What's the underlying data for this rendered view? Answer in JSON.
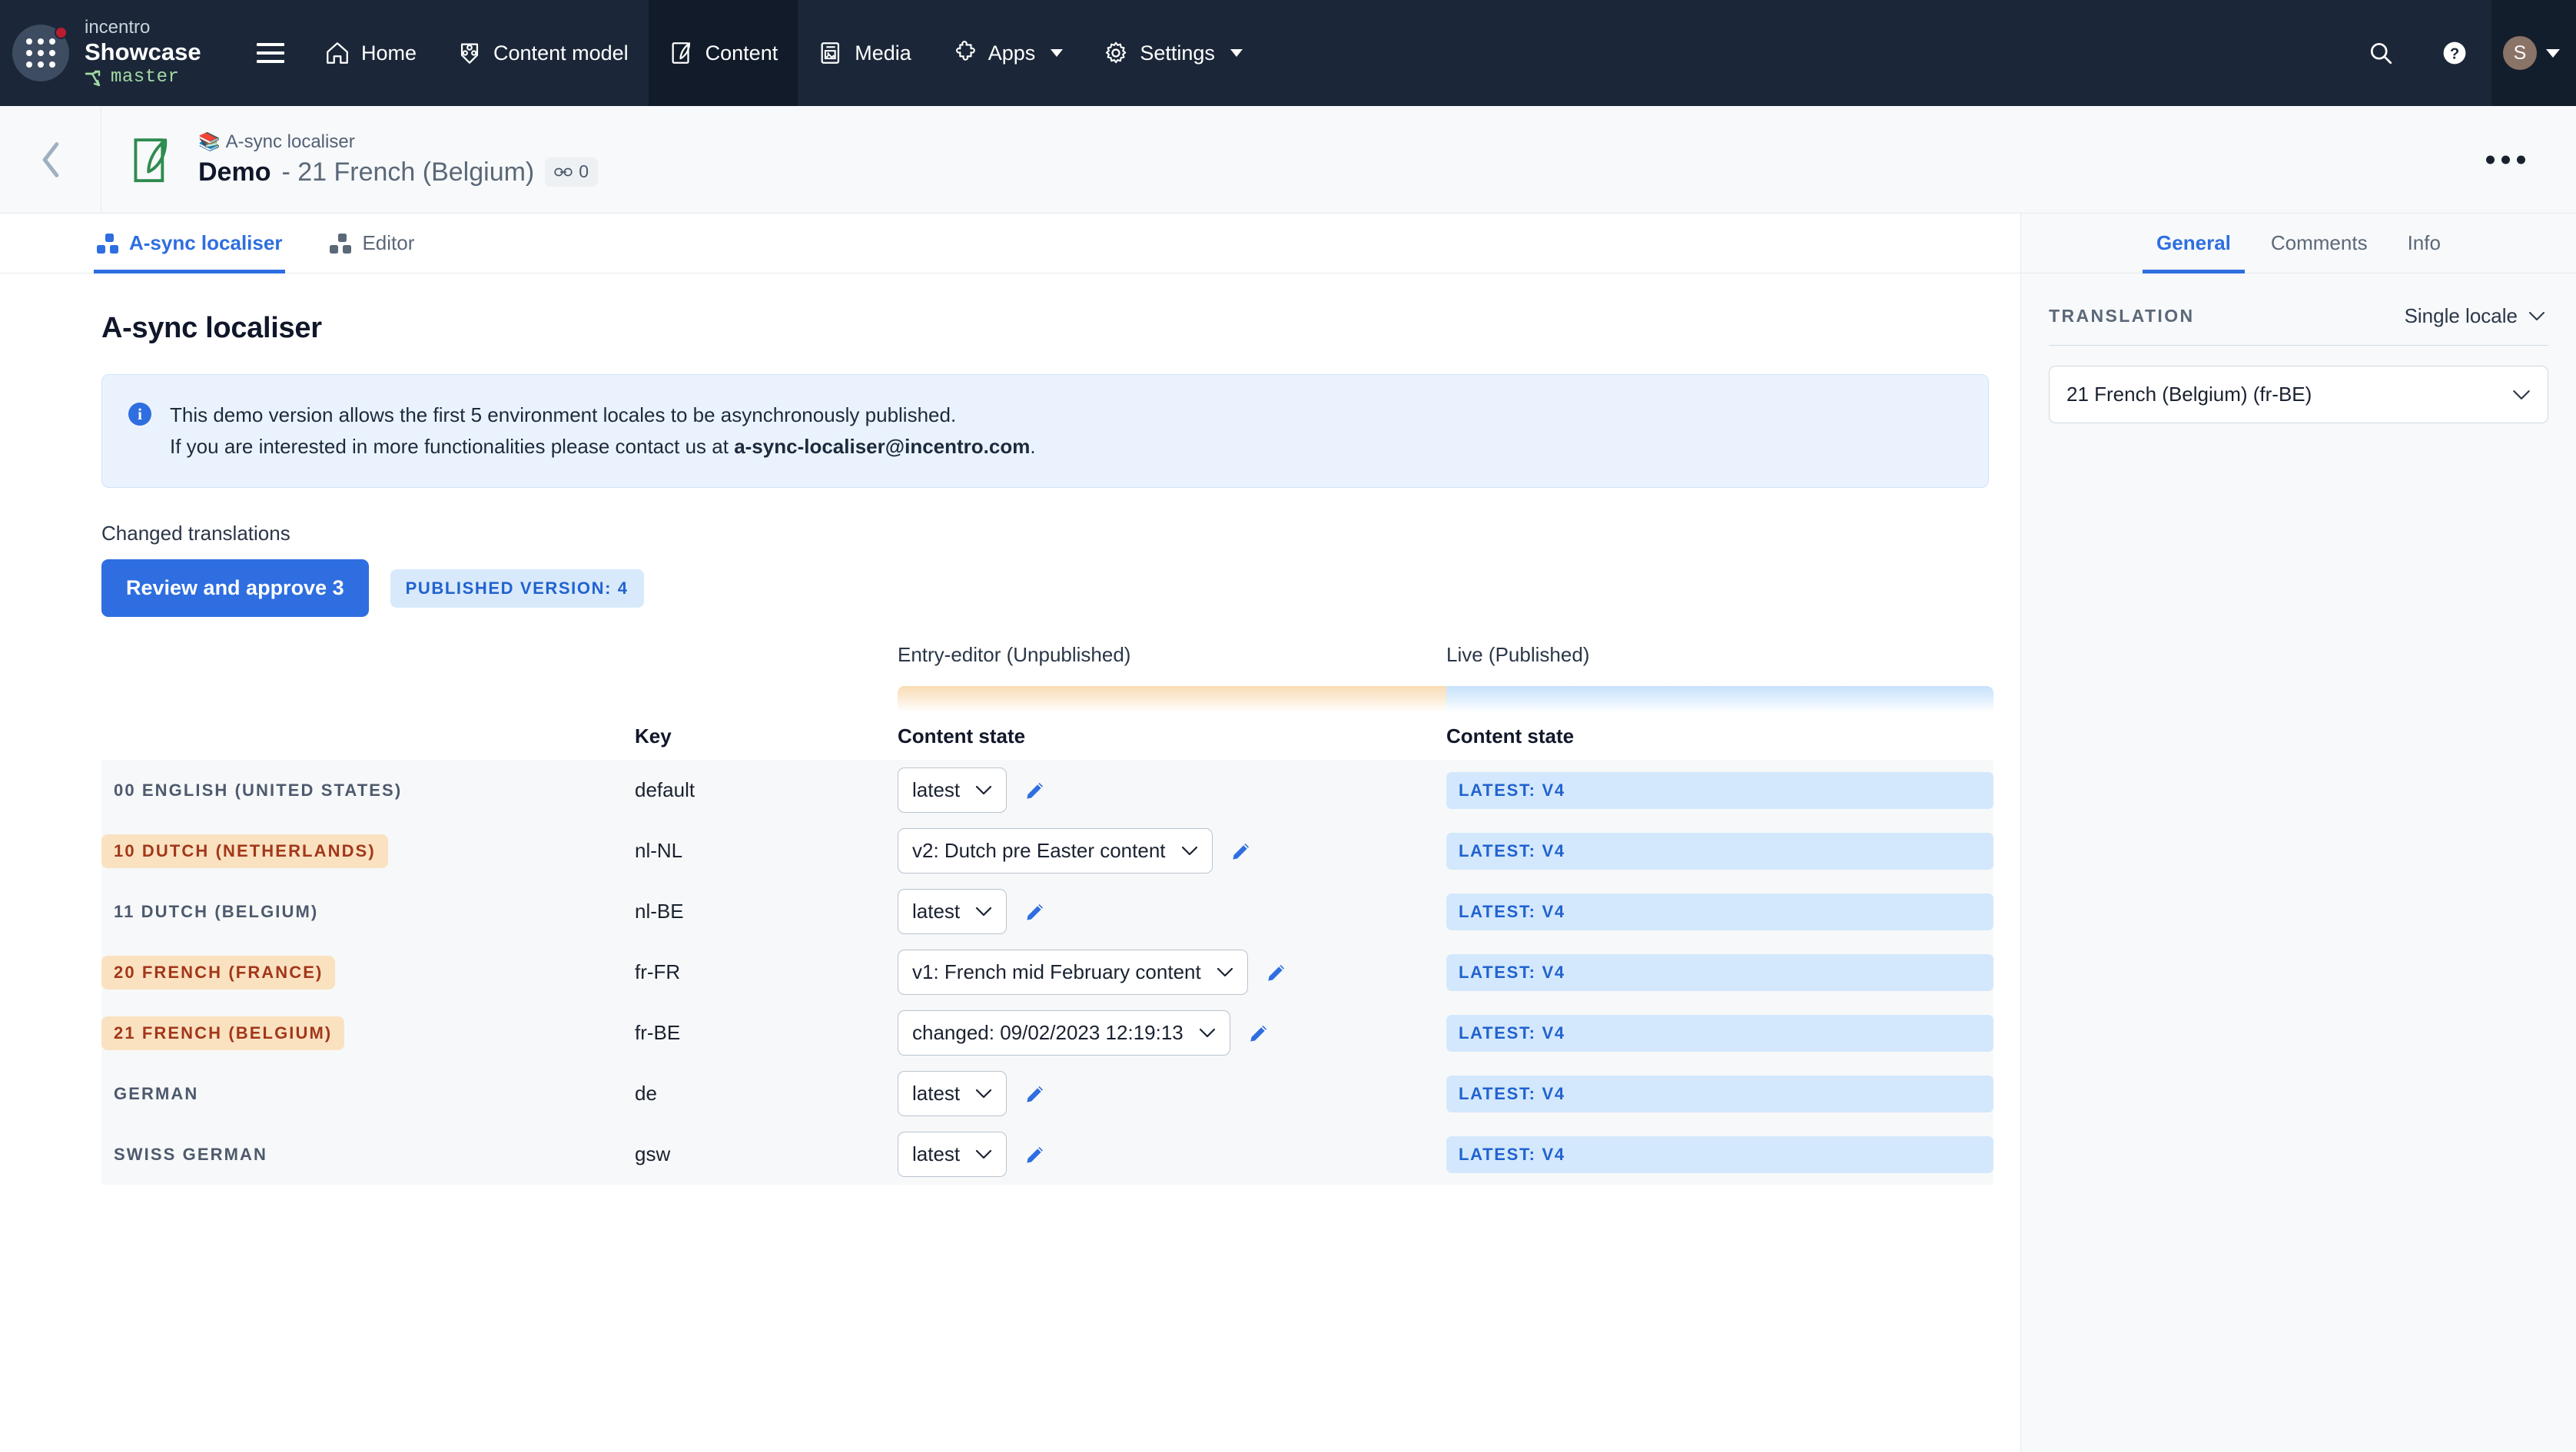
{
  "topnav": {
    "org_name": "incentro",
    "space_name": "Showcase",
    "environment": "master",
    "items": [
      {
        "label": "Home",
        "icon": "home-icon",
        "active": false,
        "caret": false
      },
      {
        "label": "Content model",
        "icon": "content-model-icon",
        "active": false,
        "caret": false
      },
      {
        "label": "Content",
        "icon": "content-icon",
        "active": true,
        "caret": false
      },
      {
        "label": "Media",
        "icon": "media-icon",
        "active": false,
        "caret": false
      },
      {
        "label": "Apps",
        "icon": "apps-icon",
        "active": false,
        "caret": true
      },
      {
        "label": "Settings",
        "icon": "settings-icon",
        "active": false,
        "caret": true
      }
    ],
    "avatar_initial": "S",
    "avatar_color": "#8a7367"
  },
  "entry_header": {
    "content_type": "A-sync localiser",
    "content_type_emoji": "📚",
    "title_main": "Demo",
    "title_sub": "- 21 French (Belgium)",
    "link_count": "0"
  },
  "tabs": [
    {
      "label": "A-sync localiser",
      "active": true
    },
    {
      "label": "Editor",
      "active": false
    }
  ],
  "main": {
    "page_title": "A-sync localiser",
    "banner": {
      "line1": "This demo version allows the first 5 environment locales to be asynchronously published.",
      "line2_prefix": "If you are interested in more functionalities please contact us at ",
      "line2_email": "a-sync-localiser@incentro.com",
      "line2_suffix": "."
    },
    "changed_label": "Changed translations",
    "review_button": "Review and approve 3",
    "published_version_badge": "PUBLISHED VERSION: 4"
  },
  "table": {
    "env_headers": {
      "editor": "Entry-editor (Unpublished)",
      "live": "Live (Published)"
    },
    "columns": {
      "key": "Key",
      "editor_state": "Content state",
      "live_state": "Content state"
    },
    "rows": [
      {
        "locale": "00 English (United States)",
        "highlight": false,
        "key": "default",
        "state": "latest",
        "live": "LATEST: V4"
      },
      {
        "locale": "10 Dutch (Netherlands)",
        "highlight": true,
        "key": "nl-NL",
        "state": "v2: Dutch pre Easter content",
        "live": "LATEST: V4"
      },
      {
        "locale": "11 Dutch (Belgium)",
        "highlight": false,
        "key": "nl-BE",
        "state": "latest",
        "live": "LATEST: V4"
      },
      {
        "locale": "20 French (France)",
        "highlight": true,
        "key": "fr-FR",
        "state": "v1: French mid February content",
        "live": "LATEST: V4"
      },
      {
        "locale": "21 French (Belgium)",
        "highlight": true,
        "key": "fr-BE",
        "state": "changed: 09/02/2023 12:19:13",
        "live": "LATEST: V4"
      },
      {
        "locale": "German",
        "highlight": false,
        "key": "de",
        "state": "latest",
        "live": "LATEST: V4"
      },
      {
        "locale": "Swiss German",
        "highlight": false,
        "key": "gsw",
        "state": "latest",
        "live": "LATEST: V4"
      }
    ]
  },
  "sidebar": {
    "tabs": [
      {
        "label": "General",
        "active": true
      },
      {
        "label": "Comments",
        "active": false
      },
      {
        "label": "Info",
        "active": false
      }
    ],
    "translation_label": "TRANSLATION",
    "translation_mode": "Single locale",
    "locale_value": "21 French (Belgium) (fr-BE)"
  },
  "colors": {
    "accent_blue": "#2e6ee0",
    "nav_bg": "#1b2738",
    "highlight_orange": "#fae2c1",
    "highlight_text": "#a2371a",
    "badge_blue_bg": "#d3e8fc",
    "badge_blue_text": "#2162cf",
    "env_green": "#a3d9a5"
  }
}
